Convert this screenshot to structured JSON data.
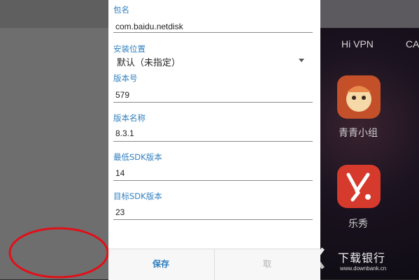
{
  "dialog": {
    "package_label": "包名",
    "package_value": "com.baidu.netdisk",
    "install_location_label": "安装位置",
    "install_location_value": "默认（未指定）",
    "version_code_label": "版本号",
    "version_code_value": "579",
    "version_name_label": "版本名称",
    "version_name_value": "8.3.1",
    "min_sdk_label": "最低SDK版本",
    "min_sdk_value": "14",
    "target_sdk_label": "目标SDK版本",
    "target_sdk_value": "23",
    "save_label": "保存",
    "cancel_label": "取"
  },
  "background": {
    "vpn_label": "Hi VPN",
    "ca_label": "CA",
    "app1_label": "青青小组",
    "app2_label": "乐秀"
  },
  "watermark": {
    "brand": "下载银行",
    "url": "www.downbank.cn"
  },
  "colors": {
    "accent": "#2f7fbf",
    "annotation": "#e0101a"
  }
}
